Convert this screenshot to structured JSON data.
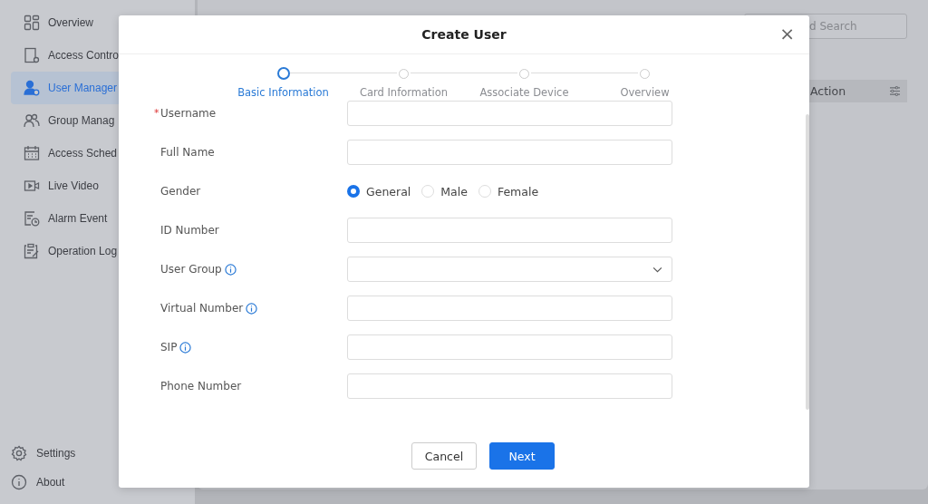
{
  "sidebar": {
    "items": [
      {
        "label": "Overview",
        "selected": false
      },
      {
        "label": "Access Contro",
        "selected": false
      },
      {
        "label": "User Manager",
        "selected": true
      },
      {
        "label": "Group Manag",
        "selected": false
      },
      {
        "label": "Access Sched",
        "selected": false
      },
      {
        "label": "Live Video",
        "selected": false
      },
      {
        "label": "Alarm Event",
        "selected": false
      },
      {
        "label": "Operation Log",
        "selected": false
      }
    ],
    "bottom_items": [
      {
        "label": "Settings"
      },
      {
        "label": "About"
      }
    ]
  },
  "background": {
    "search": {
      "value": "d Search"
    },
    "table": {
      "columns": [
        "Action"
      ]
    }
  },
  "dialog": {
    "title": "Create User",
    "close": "×",
    "steps": [
      {
        "label": "Basic Information",
        "selected": true
      },
      {
        "label": "Card Information",
        "selected": false
      },
      {
        "label": "Associate Device",
        "selected": false
      },
      {
        "label": "Overview",
        "selected": false
      }
    ],
    "fields": [
      {
        "label": "Username",
        "kind": "text",
        "required_mark": "*",
        "info": false
      },
      {
        "label": "Full Name",
        "kind": "text",
        "info": false
      },
      {
        "label": "Gender",
        "kind": "radio",
        "info": false,
        "options": [
          {
            "label": "General",
            "selected": true
          },
          {
            "label": "Male",
            "selected": false
          },
          {
            "label": "Female",
            "selected": false
          }
        ]
      },
      {
        "label": "ID Number",
        "kind": "text",
        "info": false
      },
      {
        "label": "User Group",
        "kind": "select",
        "info": true
      },
      {
        "label": "Virtual Number",
        "kind": "text",
        "info": true
      },
      {
        "label": "SIP",
        "kind": "text",
        "info": true
      },
      {
        "label": "Phone Number",
        "kind": "text",
        "info": false
      }
    ],
    "buttons": [
      {
        "label": "Cancel",
        "kind": "secondary"
      },
      {
        "label": "Next",
        "kind": "primary"
      }
    ]
  }
}
